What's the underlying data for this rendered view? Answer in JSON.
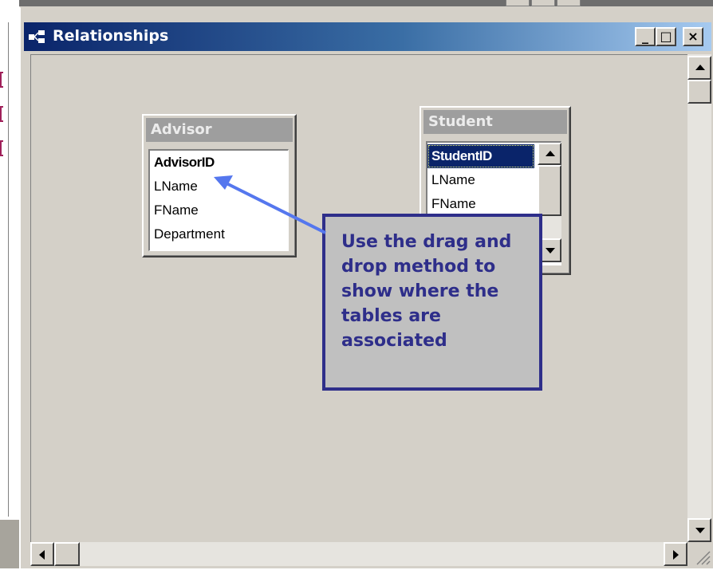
{
  "window": {
    "title": "Relationships",
    "title_icon": "relationships-icon",
    "buttons": {
      "minimize": "_",
      "maximize": "□",
      "close": "×"
    }
  },
  "tables": [
    {
      "name": "Advisor",
      "fields": [
        "AdvisorID",
        "LName",
        "FName",
        "Department"
      ],
      "key_field": "AdvisorID"
    },
    {
      "name": "Student",
      "fields": [
        "StudentID",
        "LName",
        "FName"
      ],
      "selected_field": "StudentID"
    }
  ],
  "callout": {
    "text": "Use the drag and drop method to show where the tables are associated"
  },
  "colors": {
    "title_bar_start": "#0a246a",
    "title_bar_end": "#a6caf0",
    "callout_border": "#2e2e8a",
    "callout_text": "#2e2e8a",
    "arrow": "#5577ee",
    "selected_bg": "#0a246a"
  }
}
